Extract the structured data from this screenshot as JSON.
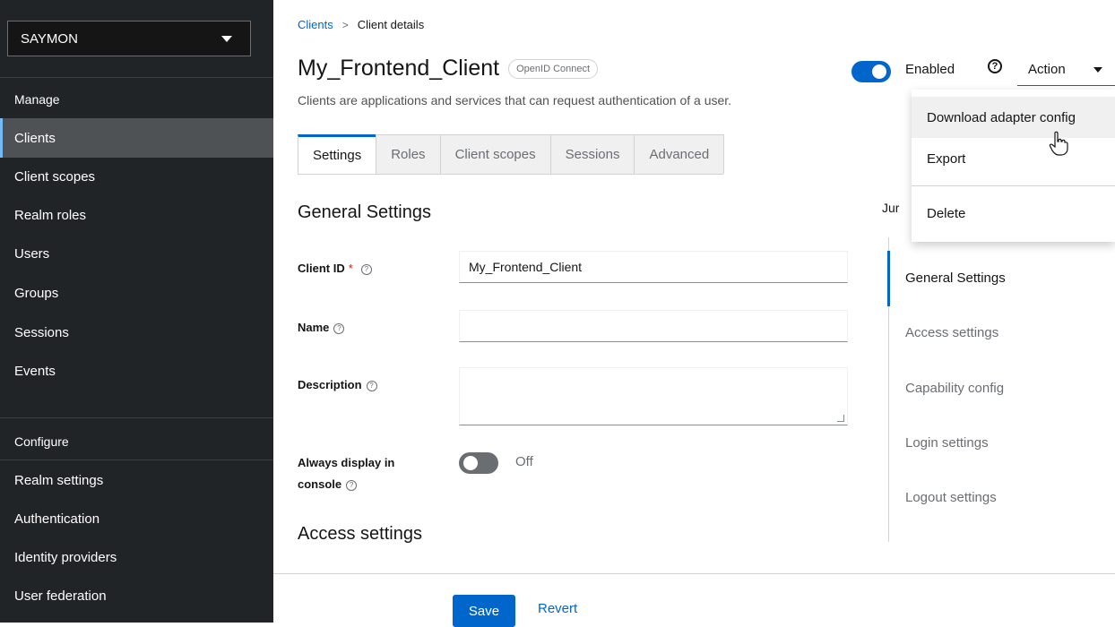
{
  "sidebar": {
    "realm": "SAYMON",
    "manage_heading": "Manage",
    "manage_items": [
      "Clients",
      "Client scopes",
      "Realm roles",
      "Users",
      "Groups",
      "Sessions",
      "Events"
    ],
    "configure_heading": "Configure",
    "configure_items": [
      "Realm settings",
      "Authentication",
      "Identity providers",
      "User federation"
    ]
  },
  "breadcrumb": {
    "parent": "Clients",
    "separator": ">",
    "current": "Client details"
  },
  "header": {
    "title": "My_Frontend_Client",
    "badge": "OpenID Connect",
    "subtitle": "Clients are applications and services that can request authentication of a user.",
    "enabled_label": "Enabled",
    "enabled": true,
    "help_glyph": "?",
    "action_label": "Action"
  },
  "tabs": [
    "Settings",
    "Roles",
    "Client scopes",
    "Sessions",
    "Advanced"
  ],
  "form": {
    "general_title": "General Settings",
    "client_id_label": "Client ID",
    "required_mark": "*",
    "client_id_value": "My_Frontend_Client",
    "name_label": "Name",
    "name_value": "",
    "description_label": "Description",
    "always_display_label_1": "Always display in",
    "always_display_label_2": "console",
    "always_display_state": "Off",
    "access_title": "Access settings"
  },
  "jump_links": {
    "heading": "Jur",
    "items": [
      "General Settings",
      "Access settings",
      "Capability config",
      "Login settings",
      "Logout settings"
    ]
  },
  "dropdown": {
    "items": [
      "Download adapter config",
      "Export",
      "Delete"
    ]
  },
  "footer": {
    "save_label": "Save",
    "revert_label": "Revert"
  },
  "colors": {
    "accent": "#0066cc",
    "sidebar_bg": "#212427",
    "active_bg": "#4f5255"
  }
}
